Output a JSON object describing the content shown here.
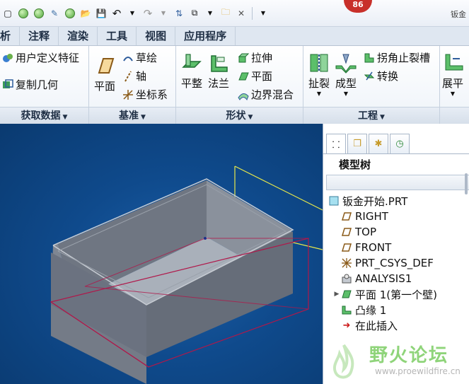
{
  "notification_count": "86",
  "qat_right_text": "钣金",
  "tabs": [
    {
      "label": "析"
    },
    {
      "label": "注释"
    },
    {
      "label": "渲染"
    },
    {
      "label": "工具"
    },
    {
      "label": "视图"
    },
    {
      "label": "应用程序"
    }
  ],
  "ribbon": {
    "get_data": {
      "label": "获取数据",
      "items": [
        {
          "label": "用户定义特征"
        },
        {
          "label": "复制几何"
        }
      ]
    },
    "datum": {
      "label": "基准",
      "plane": "平面",
      "items": [
        {
          "label": "草绘"
        },
        {
          "label": "轴"
        },
        {
          "label": "坐标系"
        }
      ]
    },
    "shapes": {
      "label": "形状",
      "flat": "平整",
      "flange": "法兰",
      "items": [
        {
          "label": "拉伸"
        },
        {
          "label": "平面"
        },
        {
          "label": "边界混合"
        }
      ]
    },
    "engineering": {
      "label": "工程",
      "rip": "扯裂",
      "form": "成型",
      "items": [
        {
          "label": "拐角止裂槽"
        },
        {
          "label": "转换"
        }
      ]
    },
    "unfold": {
      "label": "展平"
    }
  },
  "panel": {
    "title": "模型树",
    "tree": [
      {
        "label": "钣金开始.PRT",
        "icon": "part-icon"
      },
      {
        "label": "RIGHT",
        "icon": "datum-plane-icon"
      },
      {
        "label": "TOP",
        "icon": "datum-plane-icon"
      },
      {
        "label": "FRONT",
        "icon": "datum-plane-icon"
      },
      {
        "label": "PRT_CSYS_DEF",
        "icon": "csys-icon"
      },
      {
        "label": "ANALYSIS1",
        "icon": "analysis-icon"
      },
      {
        "label": "平面 1(第一个壁)",
        "icon": "flat-wall-icon"
      },
      {
        "label": "凸缘 1",
        "icon": "flange-icon"
      },
      {
        "label": "在此插入",
        "icon": "insert-arrow-icon"
      }
    ]
  },
  "watermark": {
    "title": "野火论坛",
    "url": "www.proewildfire.cn"
  },
  "colors": {
    "viewport_bg": "#0f4a8c",
    "part_gray": "#7d8490",
    "datum_yellow": "#e8e84a",
    "datum_red": "#b0184a"
  }
}
